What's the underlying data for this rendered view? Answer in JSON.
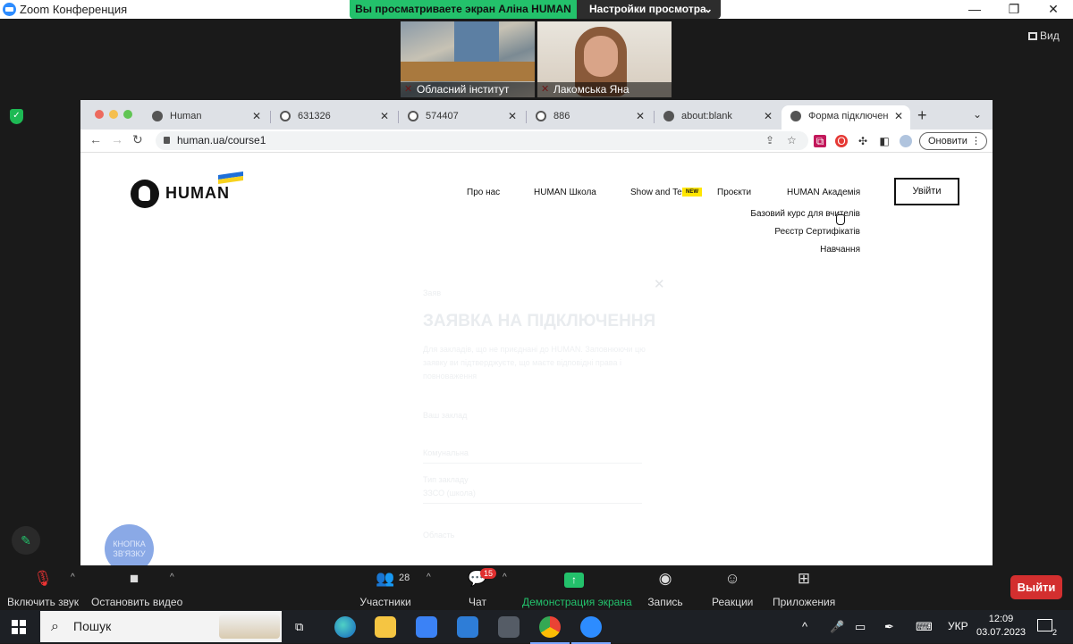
{
  "zoom": {
    "title": "Zoom Конференция",
    "share_banner_text": "Вы просматриваете экран Аліна HUMAN",
    "view_options_label": "Настройки просмотра",
    "view_label": "Вид",
    "participants_tiles": [
      {
        "name": "Обласний інститут"
      },
      {
        "name": "Лакомська Яна"
      }
    ],
    "controls": {
      "unmute_label": "Включить звук",
      "stop_video_label": "Остановить видео",
      "participants_label": "Участники",
      "participants_count": "28",
      "chat_label": "Чат",
      "chat_badge": "15",
      "share_label": "Демонстрация экрана",
      "record_label": "Запись",
      "reactions_label": "Реакции",
      "apps_label": "Приложения",
      "exit_label": "Выйти"
    }
  },
  "browser": {
    "tabs": [
      {
        "title": "Human"
      },
      {
        "title": "631326"
      },
      {
        "title": "574407"
      },
      {
        "title": "886"
      },
      {
        "title": "about:blank"
      },
      {
        "title": "Форма підключення"
      }
    ],
    "url": "human.ua/course1",
    "update_label": "Оновити"
  },
  "site": {
    "logo_text": "HUMAN",
    "nav": {
      "about": "Про нас",
      "school": "HUMAN Школа",
      "show": "Show and Tell",
      "new_badge": "NEW",
      "projects": "Проєкти",
      "academy": "HUMAN Академія",
      "login": "Увійти"
    },
    "academy_submenu": [
      "Базовий курс для вчителів",
      "Реєстр Сертифікатів",
      "Навчання"
    ],
    "modal": {
      "kicker": "Заяв",
      "title": "ЗАЯВКА НА ПІДКЛЮЧЕННЯ",
      "text": "Для закладів, що не приєднані до HUMAN. Заповнюючи цю заявку ви підтверджуєте, що маєте відповідні права і повноваження",
      "section_label": "Ваш заклад",
      "field1_value": "Комунальна",
      "field2_label": "Тип закладу",
      "field2_value": "ЗЗСО (школа)",
      "field3_label": "Область"
    },
    "contact_button": "КНОПКА ЗВ'ЯЗКУ"
  },
  "taskbar": {
    "search_placeholder": "Пошук",
    "language": "УКР",
    "time": "12:09",
    "date": "03.07.2023",
    "notifications": "2"
  }
}
